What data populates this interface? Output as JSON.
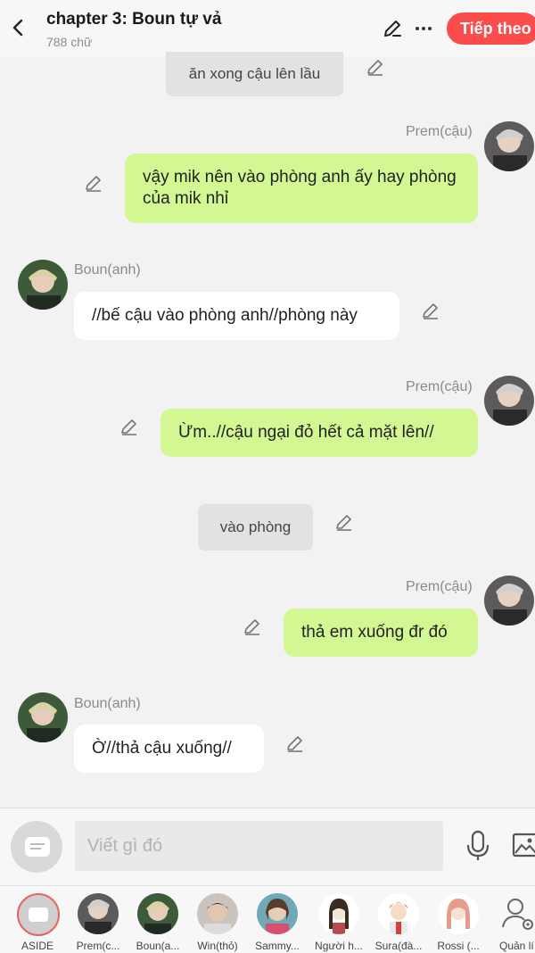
{
  "header": {
    "title": "chapter 3: Boun tự vả",
    "word_count": "788 chữ",
    "next_label": "Tiếp theo"
  },
  "messages": [
    {
      "type": "system",
      "text": "ăn xong cậu lên lầu"
    },
    {
      "type": "right",
      "sender": "Prem(cậu)",
      "text": "vậy mik nên vào phòng anh ấy hay phòng của mik nhỉ"
    },
    {
      "type": "left",
      "sender": "Boun(anh)",
      "text": "//bế cậu vào phòng anh//phòng này"
    },
    {
      "type": "right",
      "sender": "Prem(cậu)",
      "text": "Ừm..//cậu ngại đỏ hết cả mặt lên//"
    },
    {
      "type": "system",
      "text": "vào phòng"
    },
    {
      "type": "right",
      "sender": "Prem(cậu)",
      "text": "thả em xuống đr đó"
    },
    {
      "type": "left",
      "sender": "Boun(anh)",
      "text": "Ờ//thả cậu xuống//"
    }
  ],
  "input": {
    "placeholder": "Viết gì đó"
  },
  "characters": [
    {
      "label": "ASIDE"
    },
    {
      "label": "Prem(c..."
    },
    {
      "label": "Boun(a..."
    },
    {
      "label": "Win(thỏ)"
    },
    {
      "label": "Sammy..."
    },
    {
      "label": "Người h..."
    },
    {
      "label": "Sura(đà..."
    },
    {
      "label": "Rossi (..."
    },
    {
      "label": "Quản lí"
    }
  ],
  "colors": {
    "accent": "#fb4c4c",
    "bubble_right": "#d2f793",
    "bubble_left": "#ffffff",
    "system_bubble": "#e2e2e2"
  }
}
